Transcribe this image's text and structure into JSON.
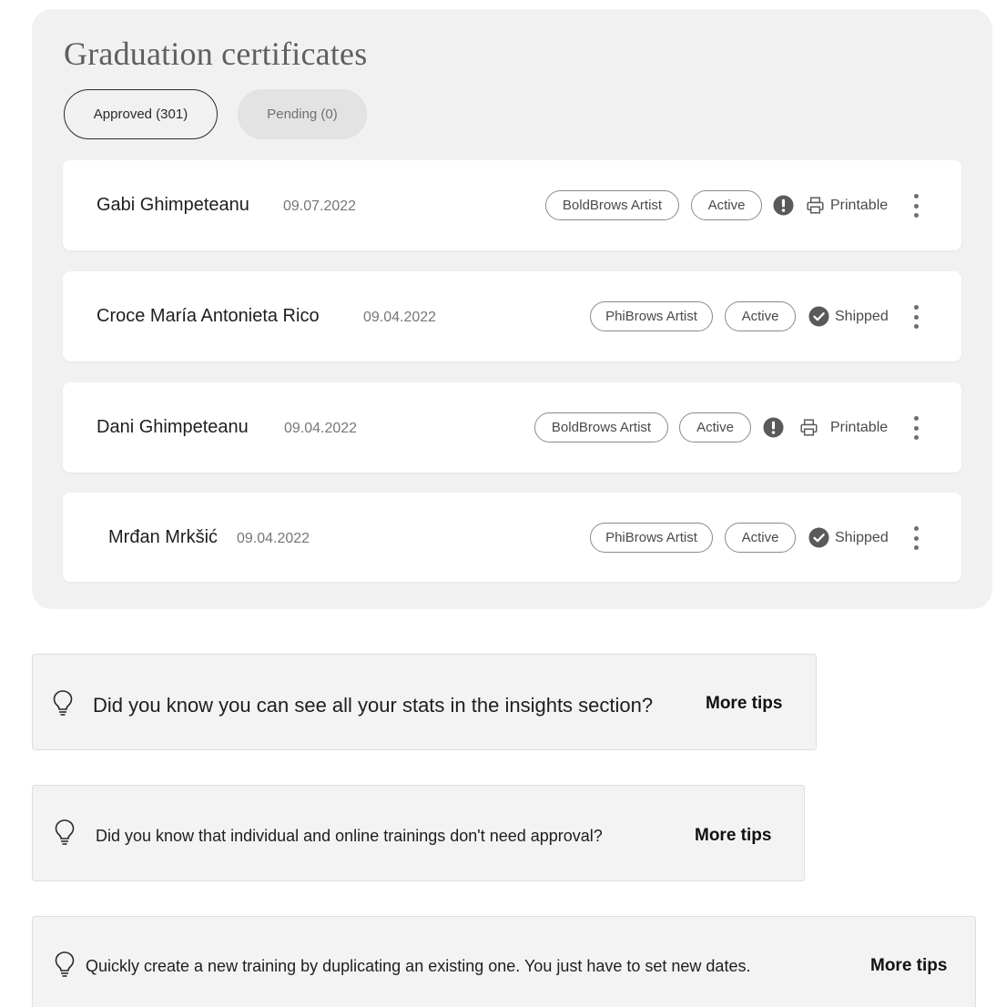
{
  "section": {
    "title": "Graduation certificates",
    "tabs": [
      {
        "label": "Approved (301)",
        "selected": true
      },
      {
        "label": "Pending (0)",
        "selected": false
      }
    ]
  },
  "certificates": [
    {
      "name": "Gabi Ghimpeteanu",
      "date": "09.07.2022",
      "program": "BoldBrows Artist",
      "state": "Active",
      "delivery": "Printable",
      "delivery_icon": "printer-icon",
      "warning_icon": "alert-icon"
    },
    {
      "name": "Croce María Antonieta Rico",
      "date": "09.04.2022",
      "program": "PhiBrows Artist",
      "state": "Active",
      "delivery": "Shipped",
      "delivery_icon": "check-icon"
    },
    {
      "name": "Dani Ghimpeteanu",
      "date": "09.04.2022",
      "program": "BoldBrows Artist",
      "state": "Active",
      "delivery": "Printable",
      "delivery_icon": "printer-icon",
      "warning_icon": "alert-icon"
    },
    {
      "name": "Mrđan Mrkšić",
      "date": "09.04.2022",
      "program": "PhiBrows Artist",
      "state": "Active",
      "delivery": "Shipped",
      "delivery_icon": "check-icon"
    }
  ],
  "tips": [
    {
      "text": "Did you know you can see all your stats in the insights section?",
      "link": "More tips",
      "icon": "lightbulb-icon"
    },
    {
      "text": "Did you know that individual and online trainings don't need approval?",
      "link": "More tips",
      "icon": "lightbulb-icon"
    },
    {
      "text": "Quickly create a new training by duplicating an existing one. You just have to set new dates.",
      "link": "More tips",
      "icon": "lightbulb-icon"
    }
  ],
  "colors": {
    "panel_background": "#f1f1f1",
    "card_background": "#ffffff",
    "icon_dark": "#5a5a5a",
    "tip_background": "#f3f3f3"
  }
}
